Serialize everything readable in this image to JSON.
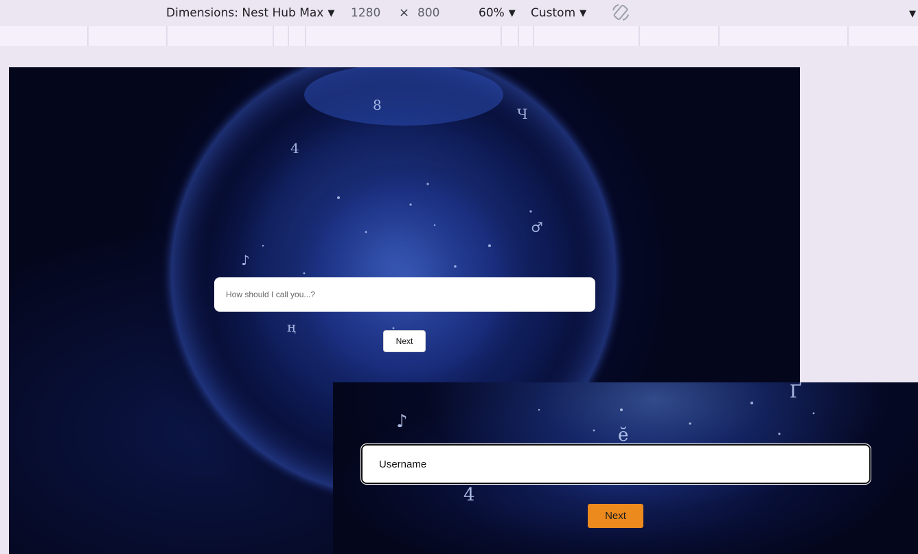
{
  "toolbar": {
    "dimensions_label": "Dimensions: Nest Hub Max",
    "width": "1280",
    "times": "×",
    "height": "800",
    "zoom": "60%",
    "throttle": "Custom"
  },
  "viewport": {
    "name_placeholder": "How should I call you...?",
    "next_label": "Next"
  },
  "inset": {
    "username_placeholder": "Username",
    "next_label": "Next",
    "next_color": "#ec8a1e"
  },
  "colors": {
    "toolbar_bg": "#ece6f2",
    "media_bar_bg": "#f5f0f9",
    "scene_bg": "#04061c"
  }
}
